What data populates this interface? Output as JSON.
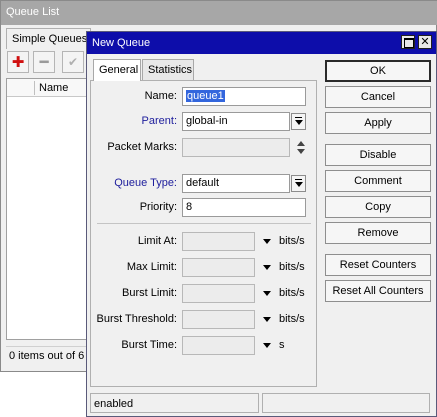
{
  "queue_list": {
    "title": "Queue List",
    "tab": "Simple Queues",
    "column_name": "Name",
    "status": "0 items out of 6",
    "toolbar": {
      "add_icon": "plus-icon",
      "remove_icon": "minus-icon",
      "enable_icon": "check-icon"
    }
  },
  "dialog": {
    "title": "New Queue",
    "tabs": [
      "General",
      "Statistics"
    ],
    "fields": {
      "name": {
        "label": "Name:",
        "value": "queue1"
      },
      "parent": {
        "label": "Parent:",
        "value": "global-in"
      },
      "packet_marks": {
        "label": "Packet Marks:",
        "value": ""
      },
      "queue_type": {
        "label": "Queue Type:",
        "value": "default"
      },
      "priority": {
        "label": "Priority:",
        "value": "8"
      },
      "limit_at": {
        "label": "Limit At:",
        "value": "",
        "unit": "bits/s"
      },
      "max_limit": {
        "label": "Max Limit:",
        "value": "",
        "unit": "bits/s"
      },
      "burst_limit": {
        "label": "Burst Limit:",
        "value": "",
        "unit": "bits/s"
      },
      "burst_threshold": {
        "label": "Burst Threshold:",
        "value": "",
        "unit": "bits/s"
      },
      "burst_time": {
        "label": "Burst Time:",
        "value": "",
        "unit": "s"
      }
    },
    "buttons": {
      "ok": "OK",
      "cancel": "Cancel",
      "apply": "Apply",
      "disable": "Disable",
      "comment": "Comment",
      "copy": "Copy",
      "remove": "Remove",
      "reset_counters": "Reset Counters",
      "reset_all_counters": "Reset All Counters"
    },
    "status": "enabled"
  },
  "colors": {
    "dialog_title_bg": "#0d0daa",
    "background_title_bg": "#a7a7a7",
    "blue_label": "#1d1d9c",
    "add_icon": "#d01010"
  }
}
